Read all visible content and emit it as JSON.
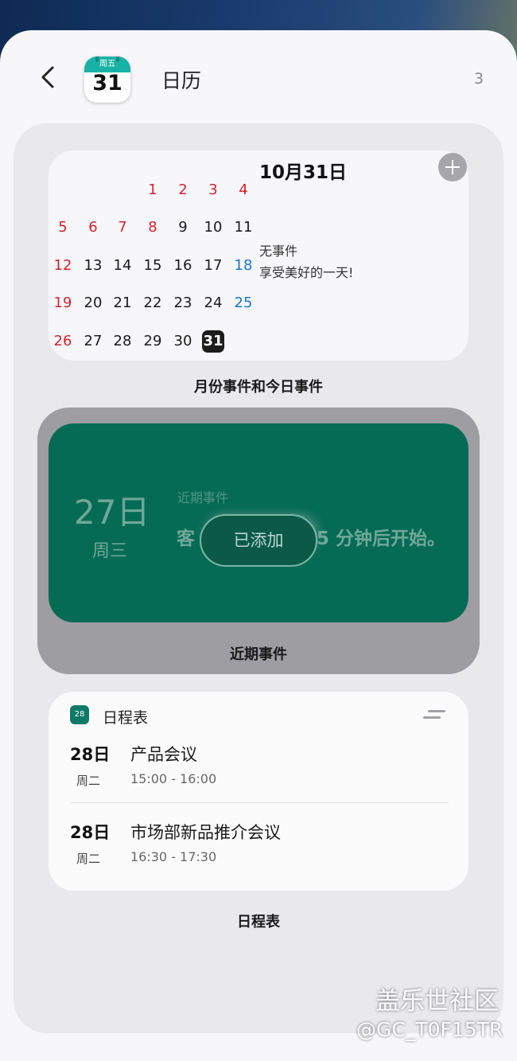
{
  "header": {
    "app_icon_weekday": "周五",
    "app_icon_day": "31",
    "title": "日历",
    "count": "3"
  },
  "month_widget": {
    "date_heading": "10月31日",
    "no_event": "无事件",
    "enjoy": "享受美好的一天!",
    "weeks": [
      [
        null,
        null,
        null,
        "1",
        "2",
        "3",
        "4"
      ],
      [
        "5",
        "6",
        "7",
        "8",
        "9",
        "10",
        "11"
      ],
      [
        "12",
        "13",
        "14",
        "15",
        "16",
        "17",
        "18"
      ],
      [
        "19",
        "20",
        "21",
        "22",
        "23",
        "24",
        "25"
      ],
      [
        "26",
        "27",
        "28",
        "29",
        "30",
        "31",
        null
      ]
    ],
    "red_days": [
      "1",
      "2",
      "3",
      "4",
      "5",
      "6",
      "7",
      "8",
      "12",
      "19",
      "26"
    ],
    "blue_days": [
      "18",
      "25"
    ],
    "today": "31",
    "caption": "月份事件和今日事件"
  },
  "upcoming_widget": {
    "day": "27日",
    "weekday": "周三",
    "label": "近期事件",
    "title_left": "客",
    "title_right": "5 分钟后开始。",
    "added_button": "已添加",
    "caption": "近期事件"
  },
  "schedule_widget": {
    "icon_day": "28",
    "title": "日程表",
    "events": [
      {
        "day": "28日",
        "weekday": "周二",
        "name": "产品会议",
        "time": "15:00 - 16:00"
      },
      {
        "day": "28日",
        "weekday": "周二",
        "name": "市场部新品推介会议",
        "time": "16:30 - 17:30"
      }
    ],
    "caption": "日程表"
  },
  "watermark": {
    "line1": "盖乐世社区",
    "line2": "@GC_T0F15TR"
  },
  "colors": {
    "accent_green": "#066b55",
    "weekend_red": "#d2222d",
    "holiday_blue": "#1a75c9"
  }
}
